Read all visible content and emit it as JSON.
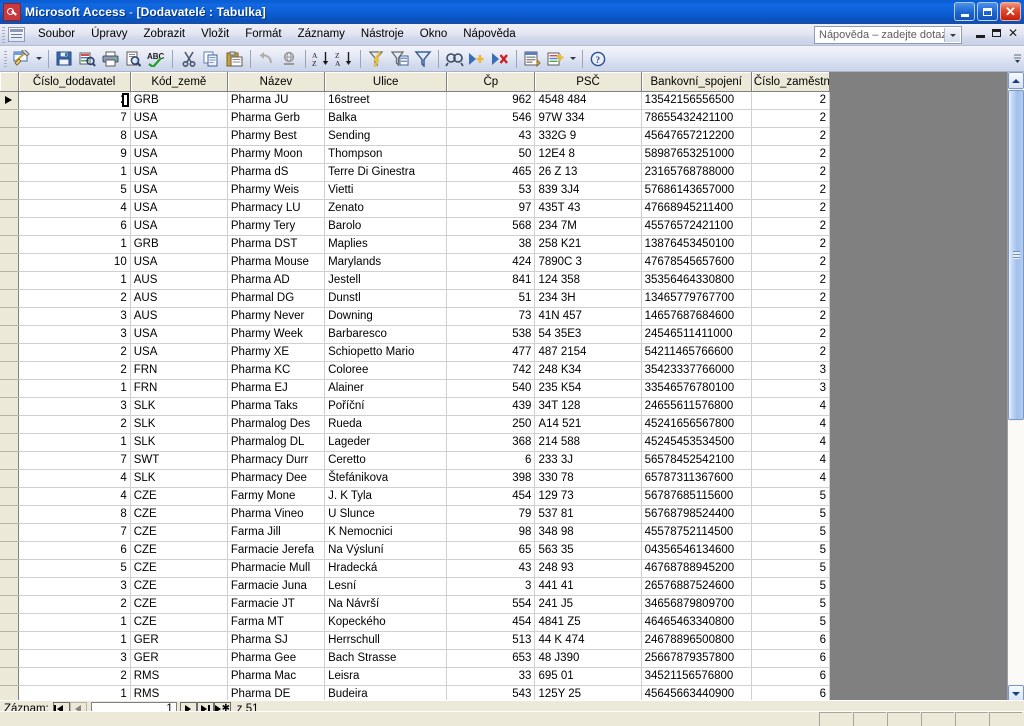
{
  "window": {
    "app_title": "Microsoft Access",
    "separator": " - ",
    "document_title": "[Dodavatelé : Tabulka]",
    "icon": "access-key-icon",
    "buttons": {
      "minimize": "Minimalizovat",
      "maximize": "Maximalizovat",
      "close": "Zavřít"
    }
  },
  "menubar": {
    "items": [
      {
        "label": "Soubor",
        "accel": "S"
      },
      {
        "label": "Úpravy",
        "accel": "a"
      },
      {
        "label": "Zobrazit",
        "accel": "Z"
      },
      {
        "label": "Vložit",
        "accel": "ž"
      },
      {
        "label": "Formát",
        "accel": "F"
      },
      {
        "label": "Záznamy",
        "accel": "m"
      },
      {
        "label": "Nástroje",
        "accel": "N"
      },
      {
        "label": "Okno",
        "accel": "O"
      },
      {
        "label": "Nápověda",
        "accel": "ě"
      }
    ],
    "help_box_placeholder": "Nápověda – zadejte dotaz",
    "mdi": {
      "minimize": "_",
      "restore": "restore",
      "close": "×"
    }
  },
  "toolbar": {
    "buttons": [
      {
        "name": "view-design-button",
        "label": "Zobrazení"
      },
      {
        "name": "view-dropdown",
        "label": "Zobrazení – rozbalit"
      },
      {
        "name": "save-button",
        "label": "Uložit"
      },
      {
        "name": "search-db-button",
        "label": "Hledat v databázi"
      },
      {
        "name": "print-button",
        "label": "Tisk"
      },
      {
        "name": "print-preview-button",
        "label": "Náhled"
      },
      {
        "name": "spelling-button",
        "label": "Pravopis"
      },
      {
        "name": "cut-button",
        "label": "Vyjmout"
      },
      {
        "name": "copy-button",
        "label": "Kopírovat"
      },
      {
        "name": "paste-button",
        "label": "Vložit"
      },
      {
        "name": "undo-button",
        "label": "Zpět"
      },
      {
        "name": "insert-hyperlink-button",
        "label": "Vložit hypertextový odkaz"
      },
      {
        "name": "sort-ascending-button",
        "label": "Seřadit vzestupně"
      },
      {
        "name": "sort-descending-button",
        "label": "Seřadit sestupně"
      },
      {
        "name": "filter-by-selection-button",
        "label": "Filtrovat podle výběru"
      },
      {
        "name": "filter-by-form-button",
        "label": "Filtrovat podle formuláře"
      },
      {
        "name": "apply-filter-button",
        "label": "Použít filtr"
      },
      {
        "name": "find-button",
        "label": "Najít"
      },
      {
        "name": "new-record-button",
        "label": "Nový záznam"
      },
      {
        "name": "delete-record-button",
        "label": "Odstranit záznam"
      },
      {
        "name": "database-window-button",
        "label": "Okno databáze"
      },
      {
        "name": "new-object-button",
        "label": "Nový objekt"
      },
      {
        "name": "new-object-dropdown",
        "label": "Nový objekt – rozbalit"
      },
      {
        "name": "help-button",
        "label": "Nápověda aplikace Microsoft Office Access"
      }
    ]
  },
  "datasheet": {
    "columns": [
      {
        "key": "cislo_dodavatele",
        "label": "Číslo_dodavatel",
        "align": "right",
        "width": 112
      },
      {
        "key": "kod_zeme",
        "label": "Kód_země",
        "align": "left",
        "width": 97
      },
      {
        "key": "nazev",
        "label": "Název",
        "align": "left",
        "width": 97
      },
      {
        "key": "ulice",
        "label": "Ulice",
        "align": "left",
        "width": 122
      },
      {
        "key": "cp",
        "label": "Čp",
        "align": "right",
        "width": 88
      },
      {
        "key": "psc",
        "label": "PSČ",
        "align": "left",
        "width": 106
      },
      {
        "key": "bankovni_spojeni",
        "label": "Bankovní_spojení",
        "align": "left",
        "width": 110
      },
      {
        "key": "cislo_zamestnance",
        "label": "Číslo_zaměstna",
        "align": "right",
        "width": 78
      }
    ],
    "rows": [
      {
        "selected": true,
        "caret": true,
        "cislo_dodavatele": "2",
        "kod_zeme": "GRB",
        "nazev": "Pharma JU",
        "ulice": "16street",
        "cp": "962",
        "psc": "4548 484",
        "bankovni_spojeni": "13542156556500",
        "cislo_zamestnance": "2"
      },
      {
        "cislo_dodavatele": "7",
        "kod_zeme": "USA",
        "nazev": "Pharma Gerb",
        "ulice": "Balka",
        "cp": "546",
        "psc": "97W 334",
        "bankovni_spojeni": "78655432421100",
        "cislo_zamestnance": "2"
      },
      {
        "cislo_dodavatele": "8",
        "kod_zeme": "USA",
        "nazev": "Pharmy Best",
        "ulice": "Sending",
        "cp": "43",
        "psc": "332G 9",
        "bankovni_spojeni": "45647657212200",
        "cislo_zamestnance": "2"
      },
      {
        "cislo_dodavatele": "9",
        "kod_zeme": "USA",
        "nazev": "Pharmy Moon",
        "ulice": "Thompson",
        "cp": "50",
        "psc": "12E4 8",
        "bankovni_spojeni": "58987653251000",
        "cislo_zamestnance": "2"
      },
      {
        "cislo_dodavatele": "1",
        "kod_zeme": "USA",
        "nazev": "Pharma dS",
        "ulice": "Terre Di Ginestra",
        "cp": "465",
        "psc": "26 Z 13",
        "bankovni_spojeni": "23165768788000",
        "cislo_zamestnance": "2"
      },
      {
        "cislo_dodavatele": "5",
        "kod_zeme": "USA",
        "nazev": "Pharmy Weis",
        "ulice": "Vietti",
        "cp": "53",
        "psc": "839 3J4",
        "bankovni_spojeni": "57686143657000",
        "cislo_zamestnance": "2"
      },
      {
        "cislo_dodavatele": "4",
        "kod_zeme": "USA",
        "nazev": "Pharmacy LU",
        "ulice": "Zenato",
        "cp": "97",
        "psc": "435T 43",
        "bankovni_spojeni": "47668945211400",
        "cislo_zamestnance": "2"
      },
      {
        "cislo_dodavatele": "6",
        "kod_zeme": "USA",
        "nazev": "Pharmy Tery",
        "ulice": "Barolo",
        "cp": "568",
        "psc": "234 7M",
        "bankovni_spojeni": "45576572421100",
        "cislo_zamestnance": "2"
      },
      {
        "cislo_dodavatele": "1",
        "kod_zeme": "GRB",
        "nazev": "Pharma DST",
        "ulice": "Maplies",
        "cp": "38",
        "psc": "258 K21",
        "bankovni_spojeni": "13876453450100",
        "cislo_zamestnance": "2"
      },
      {
        "cislo_dodavatele": "10",
        "kod_zeme": "USA",
        "nazev": "Pharma Mouse",
        "ulice": "Marylands",
        "cp": "424",
        "psc": "7890C 3",
        "bankovni_spojeni": "47678545657600",
        "cislo_zamestnance": "2"
      },
      {
        "cislo_dodavatele": "1",
        "kod_zeme": "AUS",
        "nazev": "Pharma AD",
        "ulice": "Jestell",
        "cp": "841",
        "psc": "124 358",
        "bankovni_spojeni": "35356464330800",
        "cislo_zamestnance": "2"
      },
      {
        "cislo_dodavatele": "2",
        "kod_zeme": "AUS",
        "nazev": "Pharmal DG",
        "ulice": "Dunstl",
        "cp": "51",
        "psc": "234 3H",
        "bankovni_spojeni": "13465779767700",
        "cislo_zamestnance": "2"
      },
      {
        "cislo_dodavatele": "3",
        "kod_zeme": "AUS",
        "nazev": "Pharmy Never",
        "ulice": "Downing",
        "cp": "73",
        "psc": "41N 457",
        "bankovni_spojeni": "14657687684600",
        "cislo_zamestnance": "2"
      },
      {
        "cislo_dodavatele": "3",
        "kod_zeme": "USA",
        "nazev": "Pharmy Week",
        "ulice": "Barbaresco",
        "cp": "538",
        "psc": "54 35E3",
        "bankovni_spojeni": "24546511411000",
        "cislo_zamestnance": "2"
      },
      {
        "cislo_dodavatele": "2",
        "kod_zeme": "USA",
        "nazev": "Pharmy XE",
        "ulice": "Schiopetto Mario",
        "cp": "477",
        "psc": "487 2154",
        "bankovni_spojeni": "54211465766600",
        "cislo_zamestnance": "2"
      },
      {
        "cislo_dodavatele": "2",
        "kod_zeme": "FRN",
        "nazev": "Pharma KC",
        "ulice": "Coloree",
        "cp": "742",
        "psc": "248 K34",
        "bankovni_spojeni": "35423337766000",
        "cislo_zamestnance": "3"
      },
      {
        "cislo_dodavatele": "1",
        "kod_zeme": "FRN",
        "nazev": "Pharma EJ",
        "ulice": "Alainer",
        "cp": "540",
        "psc": "235 K54",
        "bankovni_spojeni": "33546576780100",
        "cislo_zamestnance": "3"
      },
      {
        "cislo_dodavatele": "3",
        "kod_zeme": "SLK",
        "nazev": "Pharma Taks",
        "ulice": "Poříční",
        "cp": "439",
        "psc": "34T 128",
        "bankovni_spojeni": "24655611576800",
        "cislo_zamestnance": "4"
      },
      {
        "cislo_dodavatele": "2",
        "kod_zeme": "SLK",
        "nazev": "Pharmalog Des",
        "ulice": "Rueda",
        "cp": "250",
        "psc": "A14 521",
        "bankovni_spojeni": "45241656567800",
        "cislo_zamestnance": "4"
      },
      {
        "cislo_dodavatele": "1",
        "kod_zeme": "SLK",
        "nazev": "Pharmalog DL",
        "ulice": "Lageder",
        "cp": "368",
        "psc": "214 588",
        "bankovni_spojeni": "45245453534500",
        "cislo_zamestnance": "4"
      },
      {
        "cislo_dodavatele": "7",
        "kod_zeme": "SWT",
        "nazev": "Pharmacy Durr",
        "ulice": "Ceretto",
        "cp": "6",
        "psc": "233 3J",
        "bankovni_spojeni": "56578452542100",
        "cislo_zamestnance": "4"
      },
      {
        "cislo_dodavatele": "4",
        "kod_zeme": "SLK",
        "nazev": "Pharmacy Dee",
        "ulice": "Štefánikova",
        "cp": "398",
        "psc": "330 78",
        "bankovni_spojeni": "65787311367600",
        "cislo_zamestnance": "4"
      },
      {
        "cislo_dodavatele": "4",
        "kod_zeme": "CZE",
        "nazev": "Farmy Mone",
        "ulice": "J. K Tyla",
        "cp": "454",
        "psc": "129 73",
        "bankovni_spojeni": "56787685115600",
        "cislo_zamestnance": "5"
      },
      {
        "cislo_dodavatele": "8",
        "kod_zeme": "CZE",
        "nazev": "Pharma Vineo",
        "ulice": "U Slunce",
        "cp": "79",
        "psc": "537 81",
        "bankovni_spojeni": "56768798524400",
        "cislo_zamestnance": "5"
      },
      {
        "cislo_dodavatele": "7",
        "kod_zeme": "CZE",
        "nazev": "Farma Jill",
        "ulice": "K Nemocnici",
        "cp": "98",
        "psc": "348 98",
        "bankovni_spojeni": "45578752114500",
        "cislo_zamestnance": "5"
      },
      {
        "cislo_dodavatele": "6",
        "kod_zeme": "CZE",
        "nazev": "Farmacie Jerefa",
        "ulice": "Na Výsluní",
        "cp": "65",
        "psc": "563 35",
        "bankovni_spojeni": "04356546134600",
        "cislo_zamestnance": "5"
      },
      {
        "cislo_dodavatele": "5",
        "kod_zeme": "CZE",
        "nazev": "Pharmacie Mull",
        "ulice": "Hradecká",
        "cp": "43",
        "psc": "248 93",
        "bankovni_spojeni": "46768788945200",
        "cislo_zamestnance": "5"
      },
      {
        "cislo_dodavatele": "3",
        "kod_zeme": "CZE",
        "nazev": "Farmacie Juna",
        "ulice": "Lesní",
        "cp": "3",
        "psc": "441 41",
        "bankovni_spojeni": "26576887524600",
        "cislo_zamestnance": "5"
      },
      {
        "cislo_dodavatele": "2",
        "kod_zeme": "CZE",
        "nazev": "Farmacie JT",
        "ulice": "Na Návrší",
        "cp": "554",
        "psc": "241 J5",
        "bankovni_spojeni": "34656879809700",
        "cislo_zamestnance": "5"
      },
      {
        "cislo_dodavatele": "1",
        "kod_zeme": "CZE",
        "nazev": "Farma MT",
        "ulice": "Kopeckého",
        "cp": "454",
        "psc": "4841 Z5",
        "bankovni_spojeni": "46465463340800",
        "cislo_zamestnance": "5"
      },
      {
        "cislo_dodavatele": "1",
        "kod_zeme": "GER",
        "nazev": "Pharma SJ",
        "ulice": "Herrschull",
        "cp": "513",
        "psc": "44 K 474",
        "bankovni_spojeni": "24678896500800",
        "cislo_zamestnance": "6"
      },
      {
        "cislo_dodavatele": "3",
        "kod_zeme": "GER",
        "nazev": "Pharma Gee",
        "ulice": "Bach Strasse",
        "cp": "653",
        "psc": "48 J390",
        "bankovni_spojeni": "25667879357800",
        "cislo_zamestnance": "6"
      },
      {
        "cislo_dodavatele": "2",
        "kod_zeme": "RMS",
        "nazev": "Pharma Mac",
        "ulice": "Leisra",
        "cp": "33",
        "psc": "695 01",
        "bankovni_spojeni": "34521156576800",
        "cislo_zamestnance": "6"
      },
      {
        "cislo_dodavatele": "1",
        "kod_zeme": "RMS",
        "nazev": "Pharma DE",
        "ulice": "Budeira",
        "cp": "543",
        "psc": "125Y 25",
        "bankovni_spojeni": "45645663440900",
        "cislo_zamestnance": "6"
      }
    ]
  },
  "navigator": {
    "label": "Záznam:",
    "first": "První záznam",
    "previous": "Předchozí záznam",
    "current_value": "1",
    "next": "Další záznam",
    "last": "Poslední záznam",
    "new": "Nový záznam",
    "total_text": "z 51"
  },
  "statusbar": {
    "text": "",
    "panels": 6
  },
  "colors": {
    "titlebar_blue": "#0b5ed6",
    "header_beige": "#ece9d8",
    "workspace_gray": "#808080",
    "grid_line": "#d0d0d0",
    "close_red": "#c3200c"
  }
}
